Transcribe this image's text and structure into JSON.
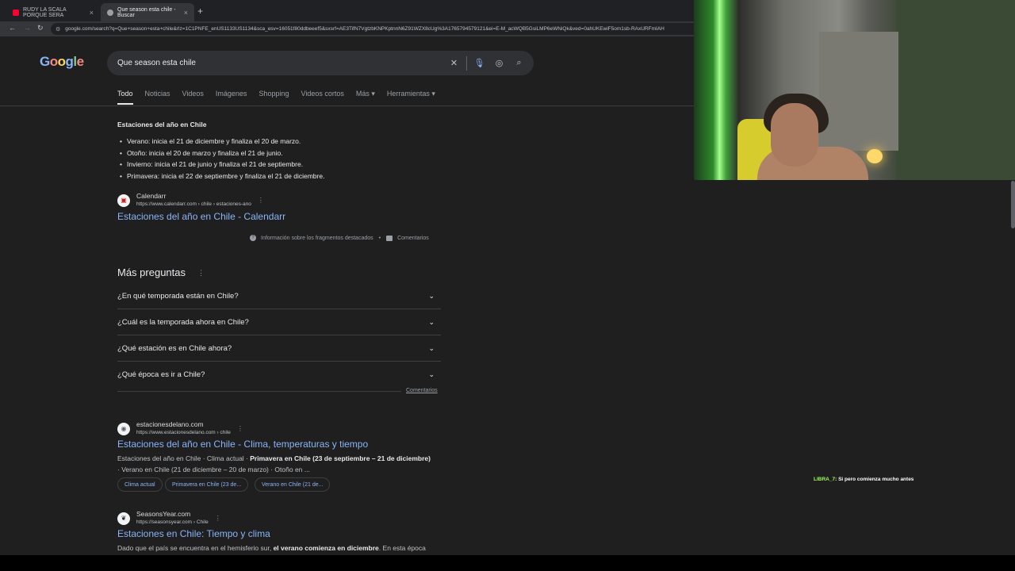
{
  "browser": {
    "tabs": [
      {
        "title": "RUDY LA SCALA PORQUE SERA",
        "favicon_color": "#ff0033",
        "active": false
      },
      {
        "title": "Que season esta chile - Buscar",
        "favicon_color": "#9aa0a6",
        "active": true
      }
    ],
    "close_glyph": "×",
    "new_tab_glyph": "+",
    "url": "google.com/search?q=Que+season+esta+chile&rlz=1C1PNFE_enUS1133US1134&sca_esv=16051f80ddbeeef5&sxsrf=AE3TifN7VgtzbKNPKptnnN6Z91WZX8cUg%3A1765794579121&ei=E-M_acWQB5GsiLMP6eWNiQk&ved=0ahUKEwiF5om1sb-RAxURFmIAH"
  },
  "google": {
    "logo": "Google",
    "query": "Que season esta chile",
    "tabs": [
      "Todo",
      "Noticias",
      "Videos",
      "Imágenes",
      "Shopping",
      "Videos cortos",
      "Más ▾",
      "Herramientas ▾"
    ]
  },
  "featured_snippet": {
    "title": "Estaciones del año en Chile",
    "bullets": [
      "Verano: inicia el 21 de diciembre y finaliza el 20 de marzo.",
      "Otoño: inicia el 20 de marzo y finaliza el 21 de junio.",
      "Invierno: inicia el 21 de junio y finaliza el 21 de septiembre.",
      "Primavera: inicia el 22 de septiembre y finaliza el 21 de diciembre."
    ],
    "source_name": "Calendarr",
    "source_url": "https://www.calendarr.com › chile › estaciones-ano",
    "link": "Estaciones del año en Chile - Calendarr",
    "about": "Información sobre los fragmentos destacados",
    "sep": "•",
    "comments": "Comentarios"
  },
  "paa": {
    "title": "Más preguntas",
    "questions": [
      "¿En qué temporada están en Chile?",
      "¿Cuál es la temporada ahora en Chile?",
      "¿Qué estación es en Chile ahora?",
      "¿Qué época es ir a Chile?"
    ],
    "comments": "Comentarios"
  },
  "results": [
    {
      "site": "estacionesdelano.com",
      "url": "https://www.estacionesdelano.com › chile",
      "title": "Estaciones del año en Chile - Clima, temperaturas y tiempo",
      "desc_line1_pre": "Estaciones del año en Chile · Clima actual · ",
      "desc_line1_bold": "Primavera en Chile (23 de septiembre – 21 de diciembre)",
      "desc_line2": "· Verano en Chile (21 de diciembre – 20 de marzo) · Otoño en ...",
      "chips": [
        "Clima actual",
        "Primavera en Chile (23 de...",
        "Verano en Chile (21 de..."
      ]
    },
    {
      "site": "SeasonsYear.com",
      "url": "https://seasonsyear.com › Chile",
      "title": "Estaciones en Chile: Tiempo y clima",
      "desc_pre": "Dado que el país se encuentra en el hemisferio sur, ",
      "desc_bold": "el verano comienza en diciembre",
      "desc_post": ". En esta época"
    }
  ],
  "chat": {
    "user": "LIBRA_7",
    "message": ": Si pero comienza mucho antes"
  }
}
